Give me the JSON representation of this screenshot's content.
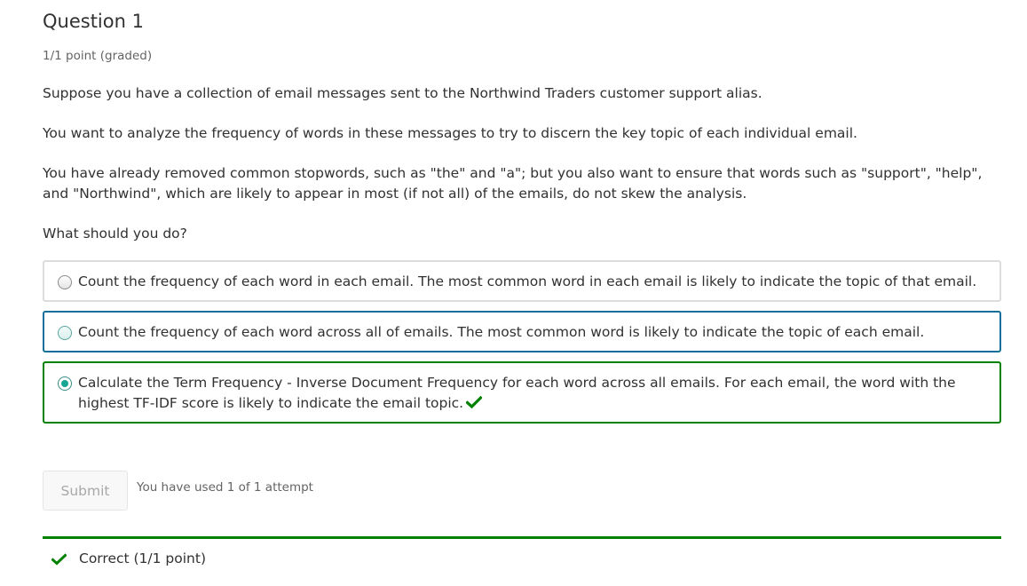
{
  "question": {
    "title": "Question 1",
    "points": "1/1 point (graded)",
    "paragraphs": [
      "Suppose you have a collection of email messages sent to the Northwind Traders customer support alias.",
      "You want to analyze the frequency of words in these messages to try to discern the key topic of each individual email.",
      "You have already removed common stopwords, such as \"the\" and \"a\"; but you also want to ensure that words such as \"support\", \"help\", and \"Northwind\", which are likely to appear in most (if not all) of the emails, do not skew the analysis.",
      "What should you do?"
    ]
  },
  "options": [
    {
      "label": "Count the frequency of each word in each email. The most common word in each email is likely to indicate the topic of that email.",
      "selected": false,
      "state": "default"
    },
    {
      "label": "Count the frequency of each word across all of emails. The most common word is likely to indicate the topic of each email.",
      "selected": false,
      "state": "focused"
    },
    {
      "label": "Calculate the Term Frequency - Inverse Document Frequency for each word across all emails. For each email, the word with the highest TF-IDF score is likely to indicate the email topic.",
      "selected": true,
      "state": "correct",
      "icon": "checkmark-icon"
    }
  ],
  "actions": {
    "submit_label": "Submit",
    "attempts_text": "You have used 1 of 1 attempt"
  },
  "status": {
    "text": "Correct (1/1 point)",
    "icon": "checkmark-icon"
  },
  "colors": {
    "correct_green": "#008100",
    "focus_blue": "#126f9a",
    "default_border": "#dcdcdc",
    "radio_selected": "#18a595",
    "text": "#313131",
    "muted_text": "#646464"
  }
}
